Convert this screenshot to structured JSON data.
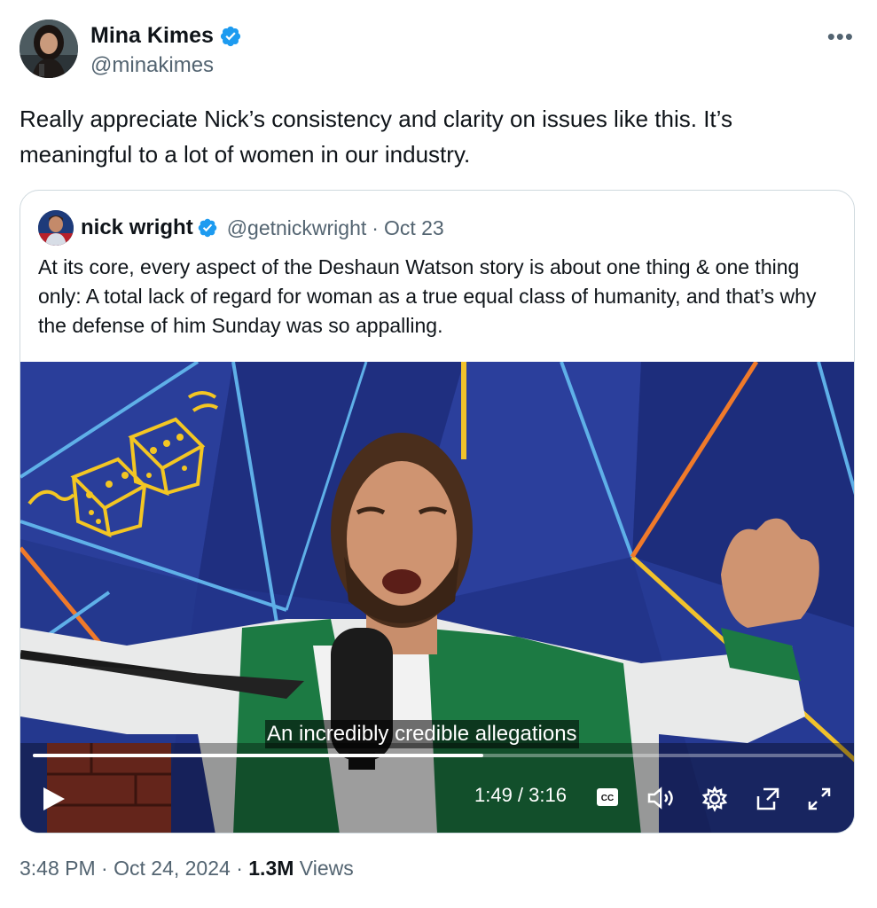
{
  "author": {
    "display_name": "Mina Kimes",
    "handle": "@minakimes",
    "verified": true,
    "more_icon": "more-horizontal-icon"
  },
  "tweet": {
    "text": "Really appreciate Nick’s consistency and clarity on issues like this. It’s meaningful to a lot of women in our industry."
  },
  "quoted": {
    "display_name": "nick wright",
    "handle": "@getnickwright",
    "separator": "·",
    "date": "Oct 23",
    "verified": true,
    "text": "At its core, every aspect of the Deshaun Watson story is about one thing & one thing only: A total lack of regard for woman as a true equal class of humanity, and that’s why the defense of him Sunday was so appalling."
  },
  "video": {
    "caption": "An incredibly credible allegations",
    "time_display": "1:49 / 3:16",
    "progress": 0.556,
    "controls": [
      "play-icon",
      "closed-captions-icon",
      "volume-icon",
      "settings-icon",
      "pop-out-icon",
      "fullscreen-icon"
    ]
  },
  "footer": {
    "time": "3:48 PM",
    "sep1": "·",
    "date": "Oct 24, 2024",
    "sep2": "·",
    "views_count": "1.3M",
    "views_label": "Views"
  },
  "colors": {
    "verified_blue": "#1d9bf0",
    "secondary_text": "#536471",
    "border": "#cfd9de"
  }
}
